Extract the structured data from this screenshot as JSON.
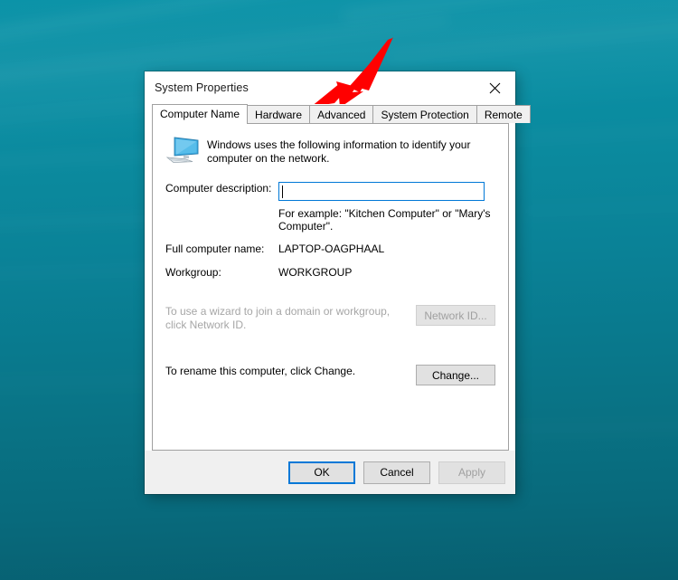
{
  "desktop": {
    "wallpaper_color": "#0a8ea3",
    "wallpaper_color_bottom": "#075f70"
  },
  "dialog": {
    "title": "System Properties",
    "close_label": "✕",
    "tabs": [
      {
        "label": "Computer Name",
        "active": true
      },
      {
        "label": "Hardware",
        "active": false
      },
      {
        "label": "Advanced",
        "active": false
      },
      {
        "label": "System Protection",
        "active": false
      },
      {
        "label": "Remote",
        "active": false
      }
    ],
    "intro": {
      "icon": "computer-monitor-icon",
      "text": "Windows uses the following information to identify your computer on the network."
    },
    "fields": {
      "description_label": "Computer description:",
      "description_value": "",
      "description_placeholder": "",
      "description_hint": "For example: \"Kitchen Computer\" or \"Mary's Computer\".",
      "full_name_label": "Full computer name:",
      "full_name_value": "LAPTOP-OAGPHAAL",
      "workgroup_label": "Workgroup:",
      "workgroup_value": "WORKGROUP"
    },
    "actions": {
      "network_id_text": "To use a wizard to join a domain or workgroup, click Network ID.",
      "network_id_button": "Network ID...",
      "network_id_enabled": false,
      "change_text": "To rename this computer, click Change.",
      "change_button": "Change...",
      "change_enabled": true
    },
    "footer": {
      "ok_label": "OK",
      "cancel_label": "Cancel",
      "apply_label": "Apply",
      "apply_enabled": false,
      "default_button": "OK",
      "focus_color": "#0078d7"
    }
  },
  "annotation": {
    "arrow_color": "#ff0000",
    "arrow_points_to": "Advanced"
  }
}
